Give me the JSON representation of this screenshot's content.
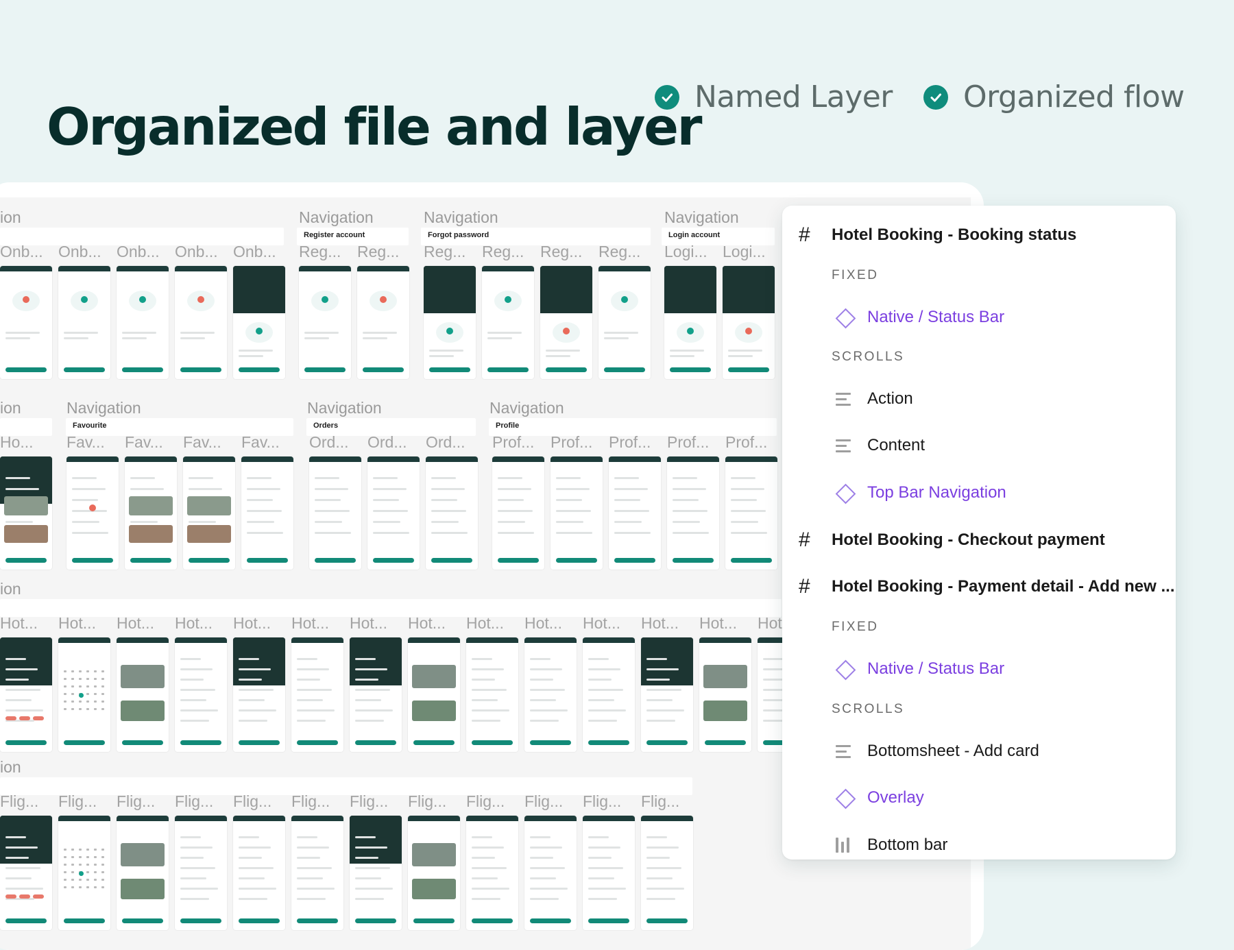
{
  "headline": "Organized file and layer",
  "features": [
    {
      "label": "Named Layer",
      "icon": "check-circle-icon"
    },
    {
      "label": "Organized flow",
      "icon": "check-circle-icon"
    }
  ],
  "canvas": {
    "rows": [
      {
        "section": "ion",
        "nav": [
          {
            "section": "Navigation",
            "title": "Register account"
          },
          {
            "section": "Navigation",
            "title": "Forgot password"
          },
          {
            "section": "Navigation",
            "title": "Login account"
          }
        ],
        "frames": [
          "Onb...",
          "Onb...",
          "Onb...",
          "Onb...",
          "Onb...",
          "Reg...",
          "Reg...",
          "Reg...",
          "Reg...",
          "Reg...",
          "Reg...",
          "Logi...",
          "Logi..."
        ]
      },
      {
        "section": "ion",
        "nav": [
          {
            "section": "Navigation",
            "title": "Favourite"
          },
          {
            "section": "Navigation",
            "title": "Orders"
          },
          {
            "section": "Navigation",
            "title": "Profile"
          }
        ],
        "frames": [
          "Ho...",
          "Fav...",
          "Fav...",
          "Fav...",
          "Fav...",
          "Ord...",
          "Ord...",
          "Ord...",
          "Prof...",
          "Prof...",
          "Prof...",
          "Prof...",
          "Prof..."
        ]
      },
      {
        "section": "ion",
        "frames": [
          "Hot...",
          "Hot...",
          "Hot...",
          "Hot...",
          "Hot...",
          "Hot...",
          "Hot...",
          "Hot...",
          "Hot...",
          "Hot...",
          "Hot...",
          "Hot...",
          "Hot...",
          "Hot"
        ]
      },
      {
        "section": "ion",
        "frames": [
          "Flig...",
          "Flig...",
          "Flig...",
          "Flig...",
          "Flig...",
          "Flig...",
          "Flig...",
          "Flig...",
          "Flig...",
          "Flig...",
          "Flig...",
          "Flig..."
        ]
      }
    ]
  },
  "layers_panel": {
    "items": [
      {
        "kind": "frame",
        "label": "Hotel Booking - Booking status",
        "icon": "frame-hash-icon"
      },
      {
        "kind": "group",
        "label": "FIXED"
      },
      {
        "kind": "component",
        "label": "Native / Status Bar",
        "icon": "component-diamond-icon"
      },
      {
        "kind": "group",
        "label": "SCROLLS"
      },
      {
        "kind": "layer",
        "label": "Action",
        "icon": "auto-layout-rows-icon"
      },
      {
        "kind": "layer",
        "label": "Content",
        "icon": "auto-layout-rows-icon"
      },
      {
        "kind": "component",
        "label": "Top Bar Navigation",
        "icon": "component-diamond-icon"
      },
      {
        "kind": "frame",
        "label": "Hotel Booking - Checkout payment",
        "icon": "frame-hash-icon"
      },
      {
        "kind": "frame",
        "label": "Hotel Booking - Payment detail - Add new ...",
        "icon": "frame-hash-icon"
      },
      {
        "kind": "group",
        "label": "FIXED"
      },
      {
        "kind": "component",
        "label": "Native / Status Bar",
        "icon": "component-diamond-icon"
      },
      {
        "kind": "group",
        "label": "SCROLLS"
      },
      {
        "kind": "layer",
        "label": "Bottomsheet - Add card",
        "icon": "auto-layout-rows-icon"
      },
      {
        "kind": "component",
        "label": "Overlay",
        "icon": "component-diamond-icon"
      },
      {
        "kind": "layer",
        "label": "Bottom bar",
        "icon": "auto-layout-columns-icon"
      }
    ]
  },
  "colors": {
    "background": "#eaf4f4",
    "headline": "#082d2b",
    "accent": "#0f8c7c",
    "component": "#7b3fe0"
  }
}
